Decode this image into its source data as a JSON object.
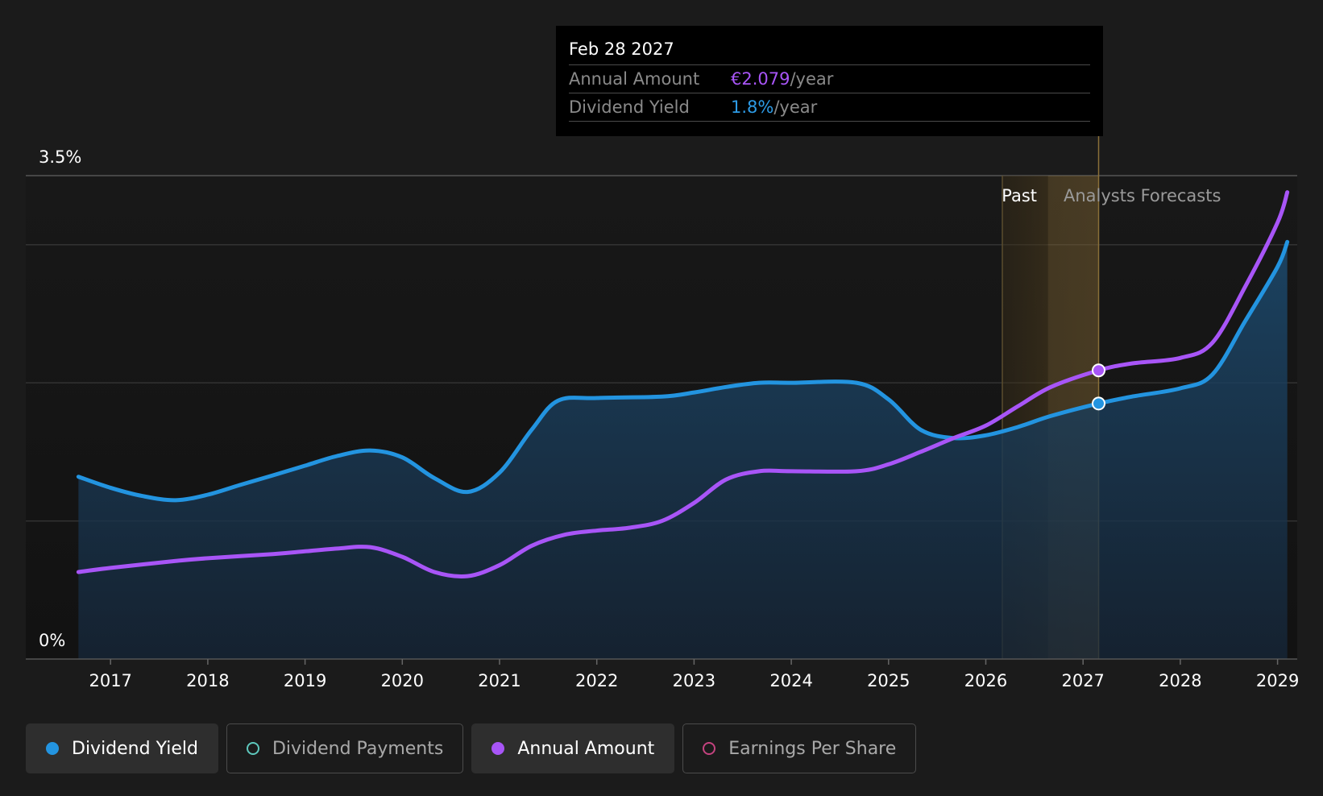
{
  "tooltip": {
    "date": "Feb 28 2027",
    "rows": [
      {
        "label": "Annual Amount",
        "value": "€2.079",
        "unit": "/year",
        "color": "#a855f7"
      },
      {
        "label": "Dividend Yield",
        "value": "1.8%",
        "unit": "/year",
        "color": "#2d9be6"
      }
    ]
  },
  "regions": {
    "past": "Past",
    "forecast": "Analysts Forecasts"
  },
  "legend": [
    {
      "label": "Dividend Yield",
      "color": "#2394e0",
      "filled": true,
      "active": true
    },
    {
      "label": "Dividend Payments",
      "color": "#5ec8bd",
      "filled": false,
      "active": false
    },
    {
      "label": "Annual Amount",
      "color": "#a855f7",
      "filled": true,
      "active": true
    },
    {
      "label": "Earnings Per Share",
      "color": "#c4437f",
      "filled": false,
      "active": false
    }
  ],
  "chart_data": {
    "type": "line",
    "y_tick_labels": [
      "0%",
      "3.5%"
    ],
    "ylim": [
      0,
      3.5
    ],
    "x_tick_labels": [
      "2017",
      "2018",
      "2019",
      "2020",
      "2021",
      "2022",
      "2023",
      "2024",
      "2025",
      "2026",
      "2027",
      "2028",
      "2029"
    ],
    "xlim": [
      2016.0,
      2029.1
    ],
    "forecast_start": 2026.17,
    "highlight_x": 2027.16,
    "grid": true,
    "series": [
      {
        "name": "Dividend Yield",
        "color": "#2394e0",
        "area": true,
        "points": [
          [
            2016.67,
            1.32
          ],
          [
            2017.0,
            1.24
          ],
          [
            2017.33,
            1.18
          ],
          [
            2017.67,
            1.15
          ],
          [
            2018.0,
            1.19
          ],
          [
            2018.33,
            1.26
          ],
          [
            2018.67,
            1.33
          ],
          [
            2019.0,
            1.4
          ],
          [
            2019.33,
            1.47
          ],
          [
            2019.67,
            1.51
          ],
          [
            2020.0,
            1.46
          ],
          [
            2020.33,
            1.31
          ],
          [
            2020.67,
            1.21
          ],
          [
            2021.0,
            1.35
          ],
          [
            2021.33,
            1.66
          ],
          [
            2021.6,
            1.87
          ],
          [
            2022.0,
            1.89
          ],
          [
            2022.67,
            1.9
          ],
          [
            2023.0,
            1.93
          ],
          [
            2023.33,
            1.97
          ],
          [
            2023.67,
            2.0
          ],
          [
            2024.0,
            2.0
          ],
          [
            2024.67,
            2.0
          ],
          [
            2025.0,
            1.88
          ],
          [
            2025.33,
            1.66
          ],
          [
            2025.67,
            1.6
          ],
          [
            2026.0,
            1.62
          ],
          [
            2026.33,
            1.68
          ],
          [
            2026.67,
            1.76
          ],
          [
            2027.16,
            1.85
          ],
          [
            2027.5,
            1.9
          ],
          [
            2028.0,
            1.96
          ],
          [
            2028.33,
            2.06
          ],
          [
            2028.67,
            2.45
          ],
          [
            2029.0,
            2.84
          ],
          [
            2029.1,
            3.02
          ]
        ]
      },
      {
        "name": "Annual Amount",
        "color": "#a855f7",
        "area": false,
        "points": [
          [
            2016.67,
            0.63
          ],
          [
            2017.0,
            0.66
          ],
          [
            2017.67,
            0.71
          ],
          [
            2018.0,
            0.73
          ],
          [
            2018.67,
            0.76
          ],
          [
            2019.0,
            0.78
          ],
          [
            2019.33,
            0.8
          ],
          [
            2019.67,
            0.81
          ],
          [
            2020.0,
            0.74
          ],
          [
            2020.33,
            0.63
          ],
          [
            2020.67,
            0.6
          ],
          [
            2021.0,
            0.68
          ],
          [
            2021.33,
            0.82
          ],
          [
            2021.67,
            0.9
          ],
          [
            2022.0,
            0.93
          ],
          [
            2022.33,
            0.95
          ],
          [
            2022.67,
            1.0
          ],
          [
            2023.0,
            1.13
          ],
          [
            2023.33,
            1.3
          ],
          [
            2023.67,
            1.36
          ],
          [
            2024.0,
            1.36
          ],
          [
            2024.67,
            1.36
          ],
          [
            2025.0,
            1.41
          ],
          [
            2025.33,
            1.5
          ],
          [
            2025.67,
            1.6
          ],
          [
            2026.0,
            1.69
          ],
          [
            2026.33,
            1.83
          ],
          [
            2026.67,
            1.97
          ],
          [
            2027.16,
            2.09
          ],
          [
            2027.5,
            2.14
          ],
          [
            2028.0,
            2.18
          ],
          [
            2028.33,
            2.29
          ],
          [
            2028.67,
            2.7
          ],
          [
            2029.0,
            3.16
          ],
          [
            2029.1,
            3.38
          ]
        ]
      }
    ]
  }
}
